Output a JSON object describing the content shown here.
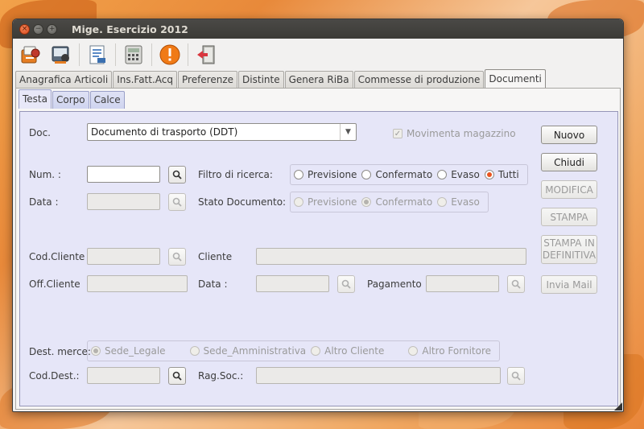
{
  "window": {
    "title": "Mige. Esercizio 2012",
    "controls": {
      "close": "×",
      "minimize": "−",
      "maximize": "+"
    }
  },
  "toolbar": {
    "icons": [
      "clients-icon",
      "users-icon",
      "document-edit-icon",
      "calculator-icon",
      "warning-icon",
      "exit-icon"
    ]
  },
  "main_tabs": [
    "Anagrafica Articoli",
    "Ins.Fatt.Acq",
    "Preferenze",
    "Distinte",
    "Genera RiBa",
    "Commesse di produzione",
    "Documenti"
  ],
  "main_tab_active": "Documenti",
  "sub_tabs": [
    "Testa",
    "Corpo",
    "Calce"
  ],
  "sub_tab_active": "Testa",
  "colors": {
    "accent": "#e95420",
    "panel_bg": "#e6e6f8",
    "titlebar": "#3c3b37"
  },
  "form": {
    "doc_label": "Doc.",
    "doc_value": "Documento di trasporto (DDT)",
    "movimenta_label": "Movimenta magazzino",
    "movimenta_checked": true,
    "num_label": "Num. :",
    "num_value": "",
    "data_label": "Data :",
    "filtro_label": "Filtro di ricerca:",
    "filtro_options": [
      "Previsione",
      "Confermato",
      "Evaso",
      "Tutti"
    ],
    "filtro_selected": "Tutti",
    "stato_label": "Stato Documento:",
    "stato_options": [
      "Previsione",
      "Confermato",
      "Evaso"
    ],
    "stato_selected": "Confermato",
    "cod_cliente_label": "Cod.Cliente",
    "cliente_label": "Cliente",
    "off_cliente_label": "Off.Cliente",
    "data2_label": "Data :",
    "pagamento_label": "Pagamento",
    "dest_merce_label": "Dest. merce:",
    "dest_options": [
      "Sede_Legale",
      "Sede_Amministrativa",
      "Altro Cliente",
      "Altro Fornitore"
    ],
    "dest_selected": "Sede_Legale",
    "cod_dest_label": "Cod.Dest.:",
    "rag_soc_label": "Rag.Soc.:"
  },
  "buttons": {
    "nuovo": "Nuovo",
    "chiudi": "Chiudi",
    "modifica": "MODIFICA",
    "stampa": "STAMPA",
    "stampa_def_1": "STAMPA IN",
    "stampa_def_2": "DEFINITIVA",
    "invia_mail": "Invia Mail"
  }
}
